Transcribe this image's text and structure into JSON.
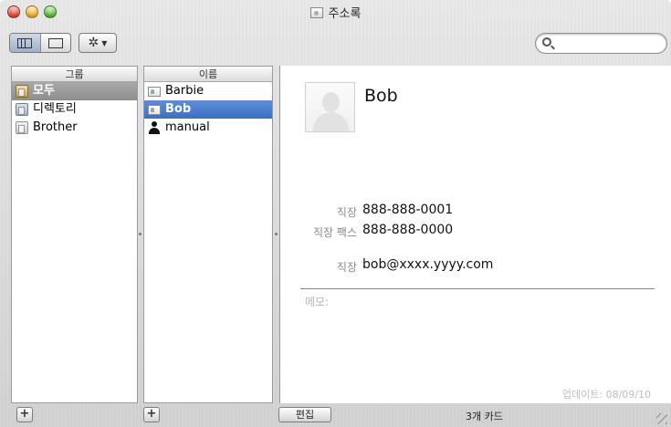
{
  "window": {
    "title": "주소록"
  },
  "toolbar": {
    "view_buttons": [
      "three-column-view",
      "card-only-view"
    ],
    "action_icon": "gear-icon",
    "search_placeholder": ""
  },
  "groups": {
    "header": "그룹",
    "items": [
      {
        "label": "모두",
        "icon": "group-icon",
        "selected": true
      },
      {
        "label": "디렉토리",
        "icon": "directory-icon",
        "selected": false
      },
      {
        "label": "Brother",
        "icon": "group-icon",
        "selected": false
      }
    ]
  },
  "names": {
    "header": "이름",
    "items": [
      {
        "label": "Barbie",
        "icon": "card-icon",
        "selected": false
      },
      {
        "label": "Bob",
        "icon": "card-icon",
        "selected": true
      },
      {
        "label": "manual",
        "icon": "person-icon",
        "selected": false
      }
    ]
  },
  "card": {
    "name": "Bob",
    "work_phone_label": "직장",
    "work_phone": "888-888-0001",
    "work_fax_label": "직장 팩스",
    "work_fax": "888-888-0000",
    "work_email_label": "직장",
    "work_email": "bob@xxxx.yyyy.com",
    "memo_label": "메모:",
    "updated": "업데이트: 08/09/10"
  },
  "bottom": {
    "add_group": "+",
    "add_person": "+",
    "edit_label": "편집",
    "card_count": "3개 카드"
  },
  "colors": {
    "selection_blue": "#3b6fc3",
    "selection_gray": "#8e8e8e"
  }
}
